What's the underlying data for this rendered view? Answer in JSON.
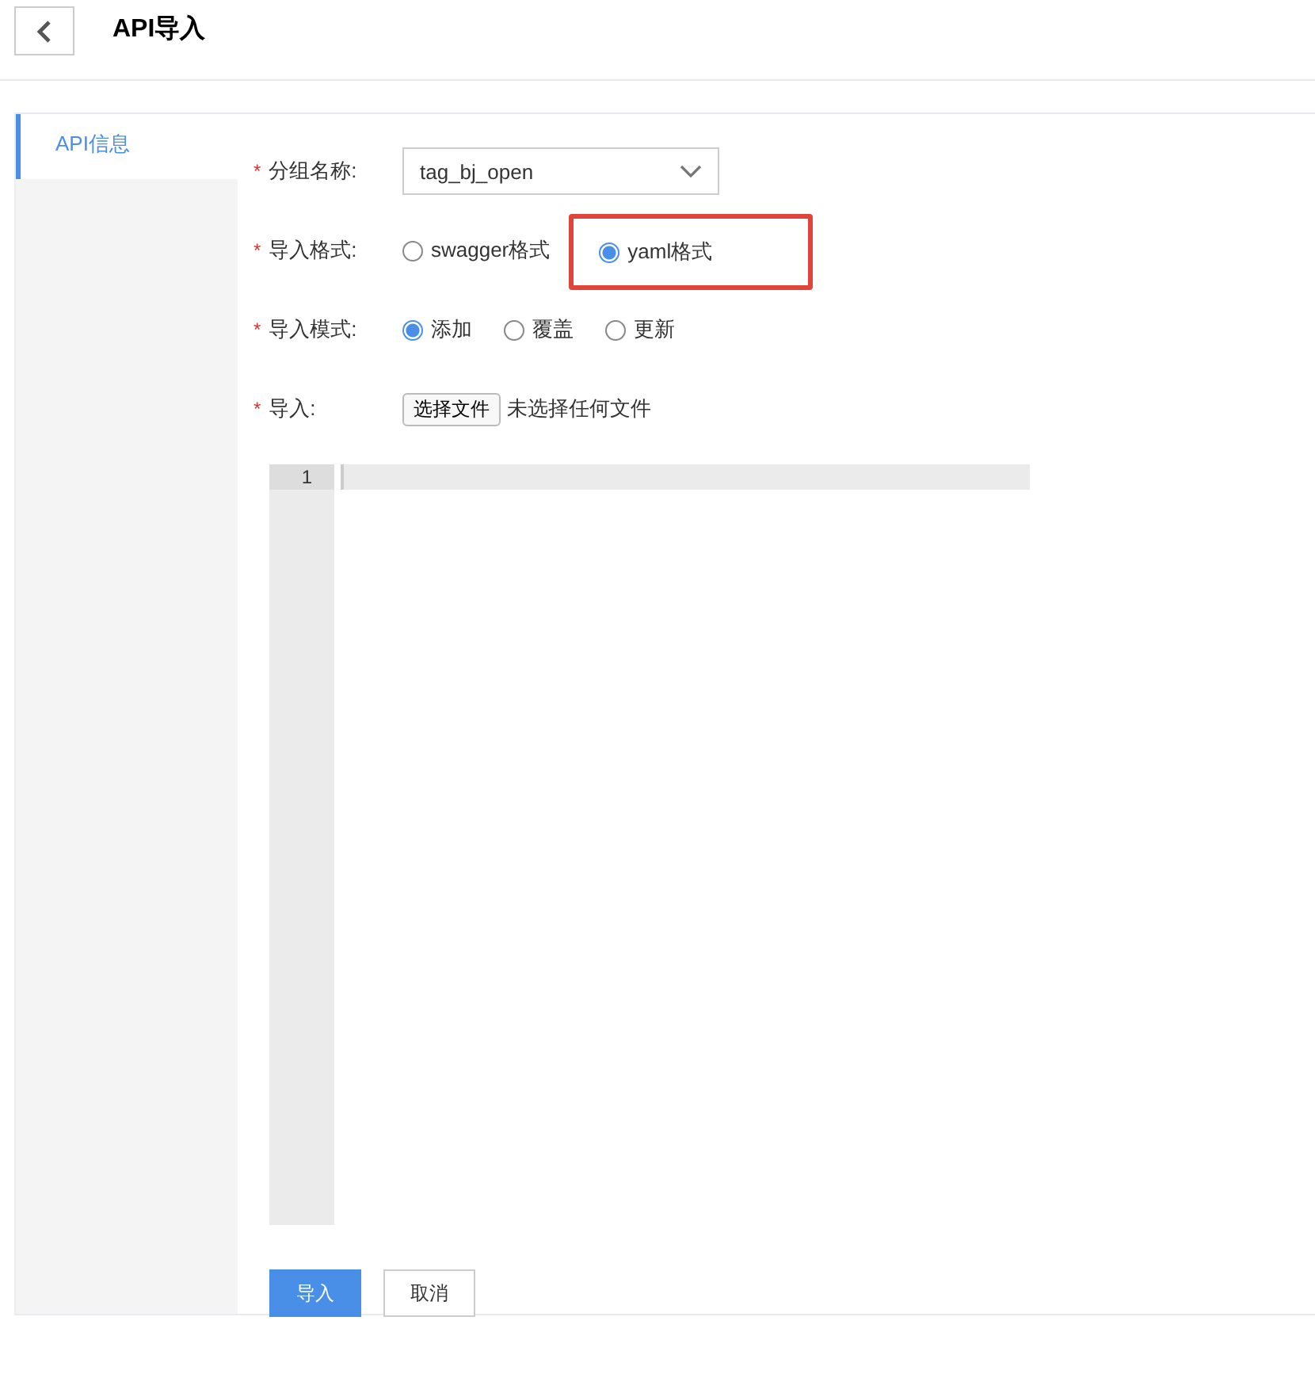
{
  "header": {
    "title": "API导入"
  },
  "sidebar": {
    "items": [
      {
        "label": "API信息",
        "selected": true
      }
    ]
  },
  "form": {
    "fields": [
      {
        "kind": "select",
        "label": "分组名称:",
        "required_mark": "*",
        "value": "tag_bj_open"
      },
      {
        "kind": "radio",
        "label": "导入格式:",
        "required_mark": "*",
        "options": [
          {
            "label": "swagger格式",
            "selected": false,
            "highlighted": false
          },
          {
            "label": "yaml格式",
            "selected": true,
            "highlighted": true
          }
        ]
      },
      {
        "kind": "radio",
        "label": "导入模式:",
        "required_mark": "*",
        "options": [
          {
            "label": "添加",
            "selected": true,
            "highlighted": false
          },
          {
            "label": "覆盖",
            "selected": false,
            "highlighted": false
          },
          {
            "label": "更新",
            "selected": false,
            "highlighted": false
          }
        ]
      },
      {
        "kind": "file",
        "label": "导入:",
        "required_mark": "*",
        "button": "选择文件",
        "status": "未选择任何文件"
      }
    ]
  },
  "editor": {
    "line_numbers": [
      "1"
    ]
  },
  "buttons": [
    {
      "label": "导入",
      "primary": true
    },
    {
      "label": "取消",
      "primary": false
    }
  ]
}
